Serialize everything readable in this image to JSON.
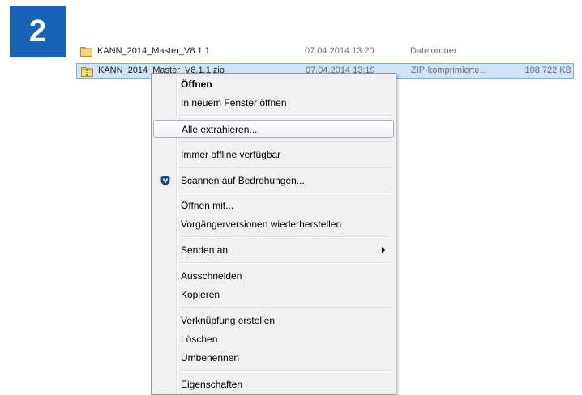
{
  "step": {
    "number": "2",
    "color": "#1565b4"
  },
  "explorer": {
    "files": [
      {
        "icon": "folder-icon",
        "name": "KANN_2014_Master_V8.1.1",
        "date": "07.04.2014 13:20",
        "type": "Dateiordner",
        "size": "",
        "selected": false
      },
      {
        "icon": "zip-folder-icon",
        "name": "KANN_2014_Master_V8.1.1.zip",
        "date": "07.04.2014 13:19",
        "type": "ZIP-komprimierte...",
        "size": "108.722 KB",
        "selected": true
      }
    ]
  },
  "context_menu": {
    "items": [
      {
        "label": "Öffnen",
        "default": true
      },
      {
        "label": "In neuem Fenster öffnen"
      },
      {
        "label": "Alle extrahieren...",
        "hover": true
      },
      {
        "label": "Immer offline verfügbar"
      },
      {
        "label": "Scannen auf Bedrohungen...",
        "icon": "shield-icon"
      },
      {
        "label": "Öffnen mit..."
      },
      {
        "label": "Vorgängerversionen wiederherstellen"
      },
      {
        "label": "Senden an",
        "submenu": true
      },
      {
        "label": "Ausschneiden"
      },
      {
        "label": "Kopieren"
      },
      {
        "label": "Verknüpfung erstellen"
      },
      {
        "label": "Löschen"
      },
      {
        "label": "Umbenennen"
      },
      {
        "label": "Eigenschaften"
      }
    ]
  }
}
